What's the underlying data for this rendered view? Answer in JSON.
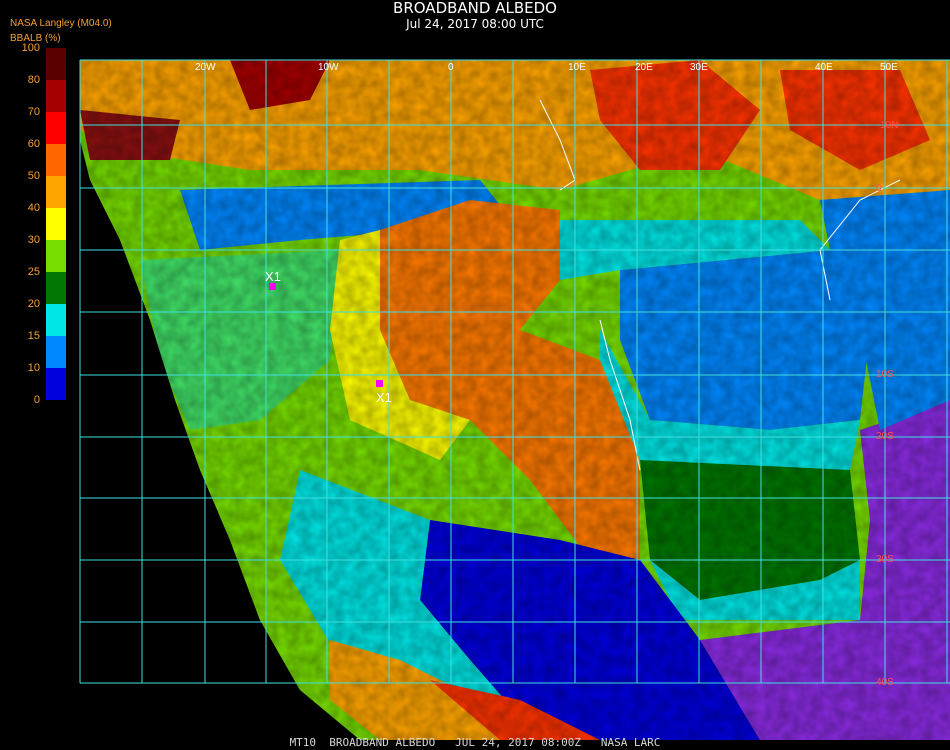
{
  "title": "BROADBAND ALBEDO",
  "subtitle": "Jul 24, 2017 08:00 UTC",
  "provider": "NASA Langley (M04.0)",
  "variable_label": "BBALB (%)",
  "colorbar": {
    "ticks": [
      "100",
      "80",
      "70",
      "60",
      "50",
      "40",
      "30",
      "25",
      "20",
      "15",
      "10",
      "0"
    ],
    "colors": [
      "#5a0000",
      "#a50000",
      "#ff0000",
      "#ff6600",
      "#ffa500",
      "#ffff00",
      "#77dd00",
      "#007700",
      "#00e6e6",
      "#0088ff",
      "#0000dd",
      "#8a2be2"
    ]
  },
  "map": {
    "longitude_labels": [
      "20W",
      "10W",
      "0",
      "10E",
      "20E",
      "30E",
      "40E",
      "50E"
    ],
    "latitude_labels": [
      "10N",
      "0",
      "10S",
      "20S",
      "30S",
      "40S"
    ],
    "markers": [
      {
        "label": "X1",
        "color": "#ff00ff"
      },
      {
        "label": "X1",
        "color": "#ff00ff"
      }
    ],
    "grid_color": "#40e0e0",
    "coast_color": "#ffffff"
  },
  "footer": "MT10  BROADBAND ALBEDO   JUL 24, 2017 08:00Z   NASA LARC"
}
